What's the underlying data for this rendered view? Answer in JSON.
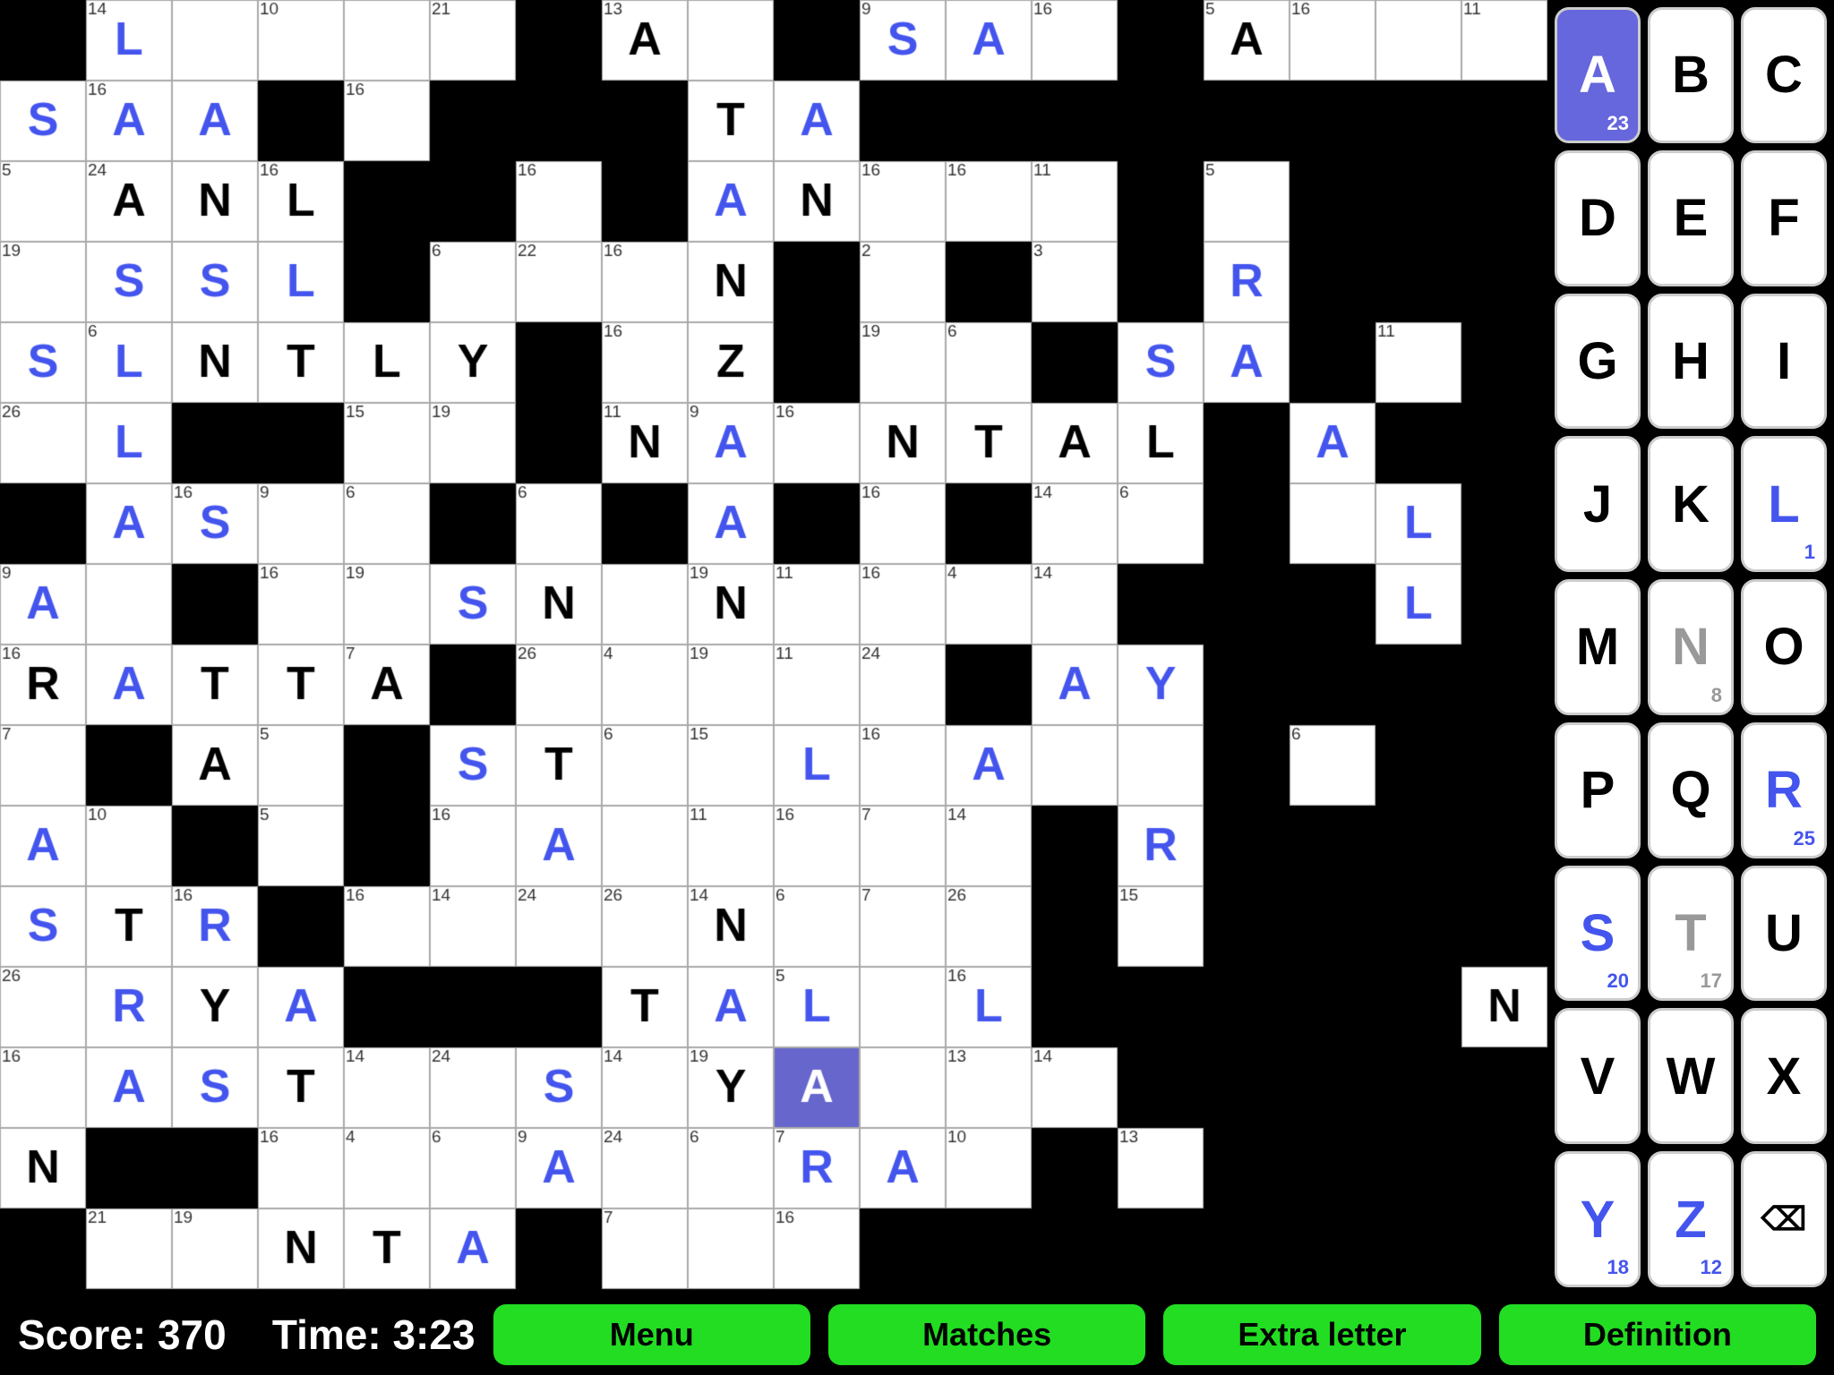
{
  "score": "Score: 370",
  "time": "Time: 3:23",
  "bottom_buttons": {
    "menu": "Menu",
    "matches": "Matches",
    "extra_letter": "Extra letter",
    "definition": "Definition"
  },
  "keyboard": [
    {
      "label": "A",
      "sub": "23",
      "style": "selected"
    },
    {
      "label": "B",
      "sub": "",
      "style": "normal"
    },
    {
      "label": "C",
      "sub": "",
      "style": "normal"
    },
    {
      "label": "D",
      "sub": "",
      "style": "normal"
    },
    {
      "label": "E",
      "sub": "",
      "style": "normal"
    },
    {
      "label": "F",
      "sub": "",
      "style": "normal"
    },
    {
      "label": "G",
      "sub": "",
      "style": "normal"
    },
    {
      "label": "H",
      "sub": "",
      "style": "normal"
    },
    {
      "label": "I",
      "sub": "",
      "style": "normal"
    },
    {
      "label": "J",
      "sub": "",
      "style": "normal"
    },
    {
      "label": "K",
      "sub": "",
      "style": "normal"
    },
    {
      "label": "L",
      "sub": "1",
      "style": "blue"
    },
    {
      "label": "M",
      "sub": "",
      "style": "normal"
    },
    {
      "label": "N",
      "sub": "8",
      "style": "gray"
    },
    {
      "label": "O",
      "sub": "",
      "style": "normal"
    },
    {
      "label": "P",
      "sub": "",
      "style": "normal"
    },
    {
      "label": "Q",
      "sub": "",
      "style": "normal"
    },
    {
      "label": "R",
      "sub": "25",
      "style": "blue"
    },
    {
      "label": "S",
      "sub": "20",
      "style": "blue"
    },
    {
      "label": "T",
      "sub": "17",
      "style": "gray"
    },
    {
      "label": "U",
      "sub": "",
      "style": "normal"
    },
    {
      "label": "V",
      "sub": "",
      "style": "normal"
    },
    {
      "label": "W",
      "sub": "",
      "style": "normal"
    },
    {
      "label": "X",
      "sub": "",
      "style": "normal"
    },
    {
      "label": "Y",
      "sub": "18",
      "style": "blue"
    },
    {
      "label": "Z",
      "sub": "12",
      "style": "blue"
    },
    {
      "label": "⌫",
      "sub": "",
      "style": "delete"
    }
  ],
  "cells": []
}
